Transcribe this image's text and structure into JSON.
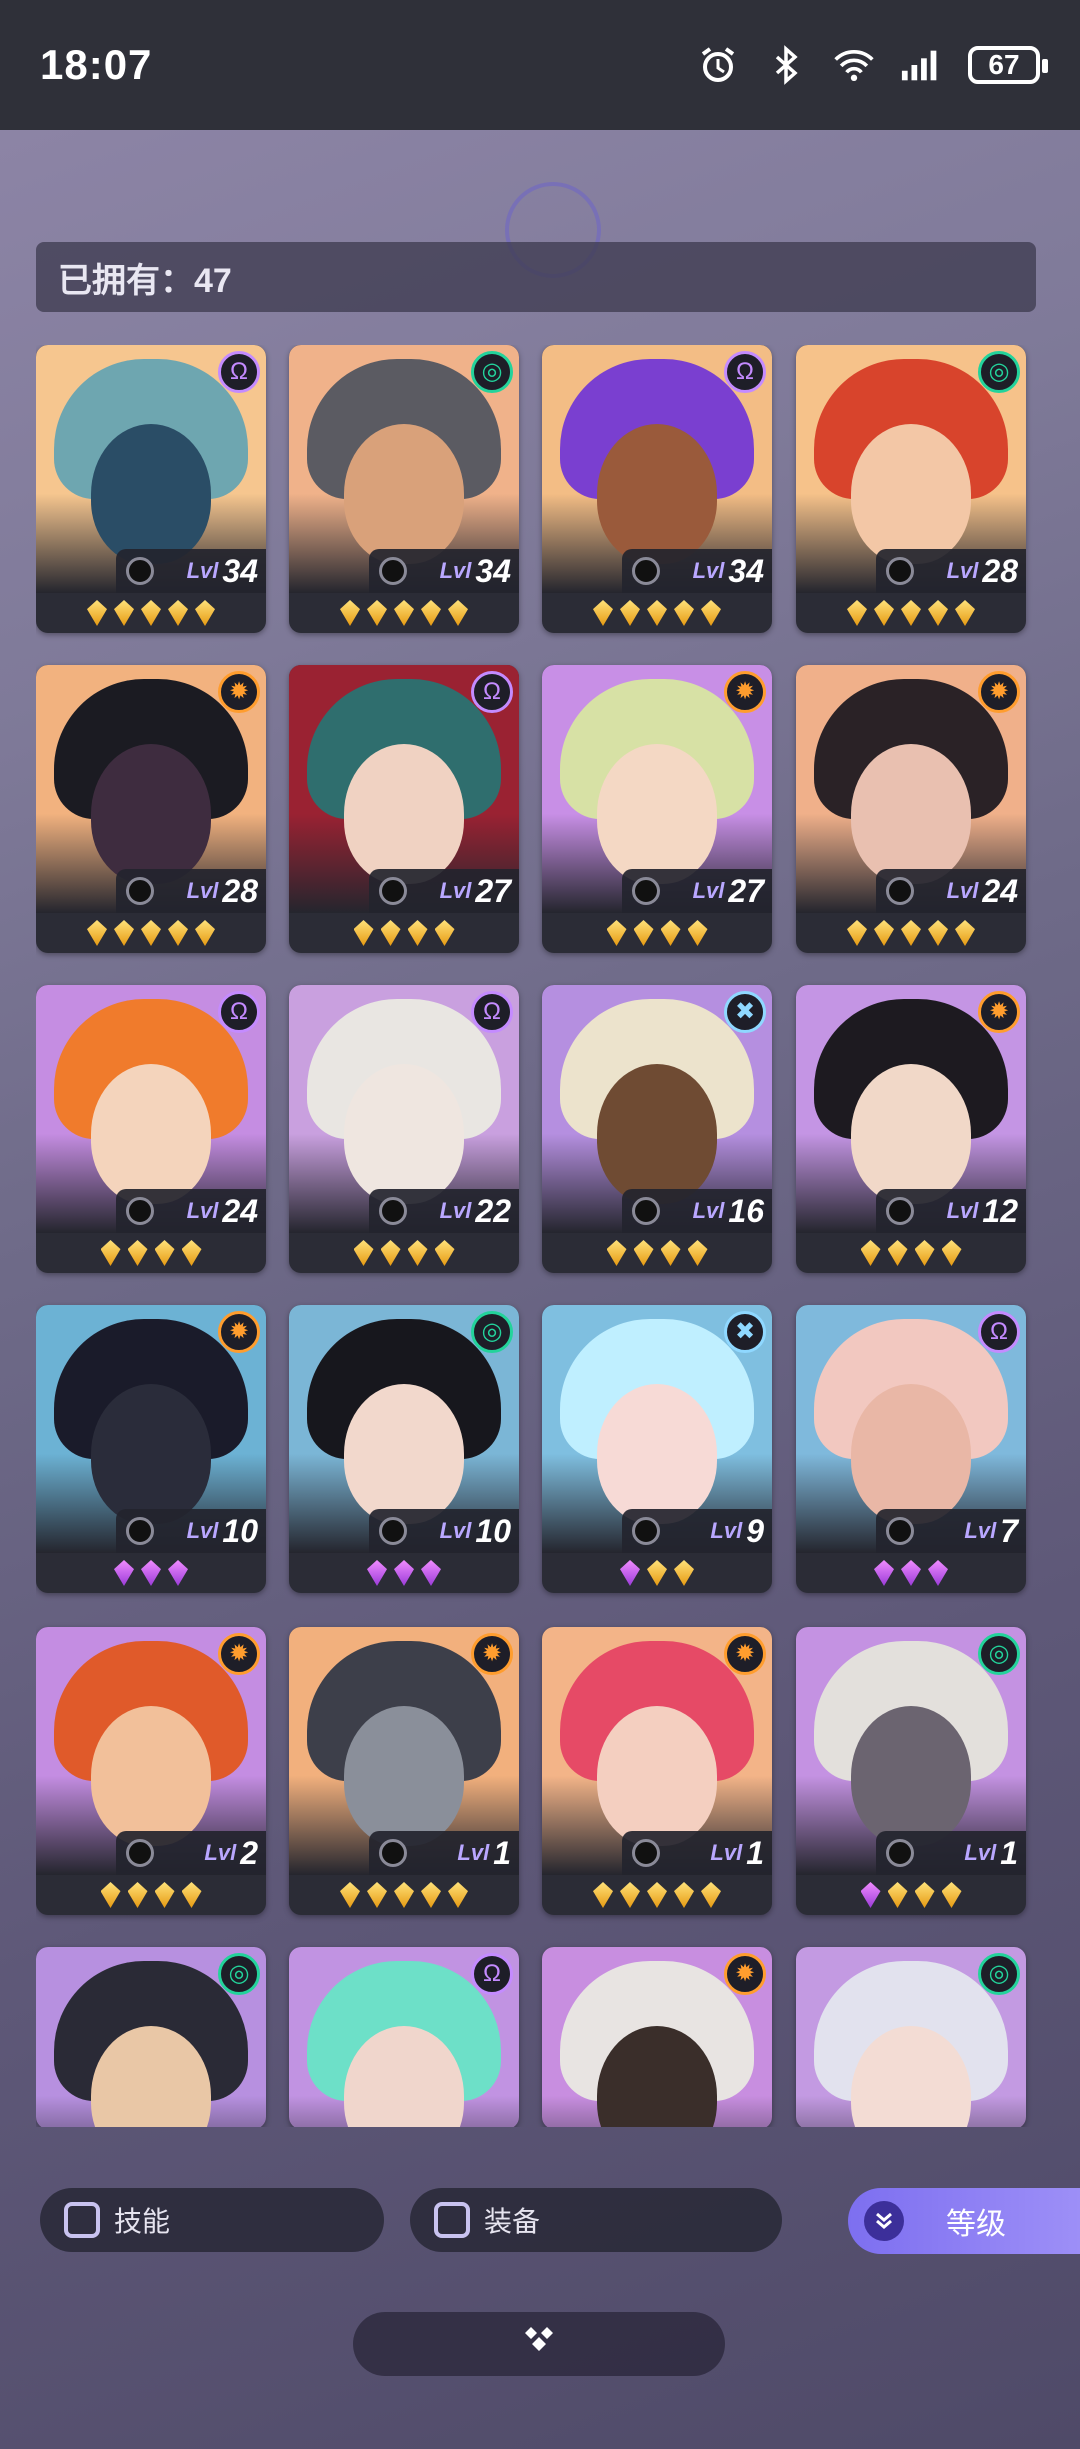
{
  "status_bar": {
    "time": "18:07",
    "battery": "67",
    "icons": [
      "alarm-icon",
      "bluetooth-icon",
      "wifi-icon",
      "signal-icon"
    ]
  },
  "owned": {
    "label": "已拥有：47"
  },
  "colors": {
    "accent": "#8a7cf3",
    "gold_gem": "#f3b62a",
    "purple_gem": "#d35cf1",
    "card_dark": "#2b2c36"
  },
  "cards": [
    {
      "level_label": "Lvl",
      "level": "34",
      "element": "purple-swirl",
      "stars": [
        "gold",
        "gold",
        "gold",
        "gold",
        "gold"
      ],
      "bg": "#f6c68f",
      "hair": "#6ea6b0",
      "skin": "#2a4d66"
    },
    {
      "level_label": "Lvl",
      "level": "34",
      "element": "green-spiral",
      "stars": [
        "gold",
        "gold",
        "gold",
        "gold",
        "gold"
      ],
      "bg": "#f0b28a",
      "hair": "#5b5b62",
      "skin": "#d9a17a"
    },
    {
      "level_label": "Lvl",
      "level": "34",
      "element": "purple-swirl",
      "stars": [
        "gold",
        "gold",
        "gold",
        "gold",
        "gold"
      ],
      "bg": "#f3bd85",
      "hair": "#7a3fd0",
      "skin": "#9a5a3b"
    },
    {
      "level_label": "Lvl",
      "level": "28",
      "element": "green-spiral",
      "stars": [
        "gold",
        "gold",
        "gold",
        "gold",
        "gold"
      ],
      "bg": "#f6c28a",
      "hair": "#d8442c",
      "skin": "#f3c7a6"
    },
    {
      "level_label": "Lvl",
      "level": "28",
      "element": "orange-sun",
      "stars": [
        "gold",
        "gold",
        "gold",
        "gold",
        "gold"
      ],
      "bg": "#f2b27f",
      "hair": "#1b1b22",
      "skin": "#3e2c3f"
    },
    {
      "level_label": "Lvl",
      "level": "27",
      "element": "purple-swirl",
      "stars": [
        "gold",
        "gold",
        "gold",
        "gold"
      ],
      "bg": "#9a2232",
      "hair": "#2f6e6e",
      "skin": "#f0d2c2"
    },
    {
      "level_label": "Lvl",
      "level": "27",
      "element": "orange-sun",
      "stars": [
        "gold",
        "gold",
        "gold",
        "gold"
      ],
      "bg": "#c88fe6",
      "hair": "#d7e1a5",
      "skin": "#f4d8c4"
    },
    {
      "level_label": "Lvl",
      "level": "24",
      "element": "orange-sun",
      "stars": [
        "gold",
        "gold",
        "gold",
        "gold",
        "gold"
      ],
      "bg": "#f0b08a",
      "hair": "#2a2226",
      "skin": "#e9c0b0"
    },
    {
      "level_label": "Lvl",
      "level": "24",
      "element": "purple-swirl",
      "stars": [
        "gold",
        "gold",
        "gold",
        "gold"
      ],
      "bg": "#c58de2",
      "hair": "#f07b2c",
      "skin": "#f4d4bc"
    },
    {
      "level_label": "Lvl",
      "level": "22",
      "element": "purple-swirl",
      "stars": [
        "gold",
        "gold",
        "gold",
        "gold"
      ],
      "bg": "#c9a0df",
      "hair": "#e9e6e2",
      "skin": "#efe6e0"
    },
    {
      "level_label": "Lvl",
      "level": "16",
      "element": "blue-cross",
      "stars": [
        "gold",
        "gold",
        "gold",
        "gold"
      ],
      "bg": "#b58fe0",
      "hair": "#ece3cc",
      "skin": "#6f4b33"
    },
    {
      "level_label": "Lvl",
      "level": "12",
      "element": "orange-sun",
      "stars": [
        "gold",
        "gold",
        "gold",
        "gold"
      ],
      "bg": "#c495e4",
      "hair": "#1d1a20",
      "skin": "#f1d8c8"
    },
    {
      "level_label": "Lvl",
      "level": "10",
      "element": "orange-sun",
      "stars": [
        "purple",
        "purple",
        "purple"
      ],
      "bg": "#6cb2d4",
      "hair": "#1a1b2a",
      "skin": "#2a2c3a"
    },
    {
      "level_label": "Lvl",
      "level": "10",
      "element": "green-spiral",
      "stars": [
        "purple",
        "purple",
        "purple"
      ],
      "bg": "#7bb6d6",
      "hair": "#17171d",
      "skin": "#f2d8cc"
    },
    {
      "level_label": "Lvl",
      "level": "9",
      "element": "blue-cross",
      "stars": [
        "purple",
        "gold",
        "gold"
      ],
      "bg": "#7fbfe0",
      "hair": "#bfefff",
      "skin": "#f7dad6"
    },
    {
      "level_label": "Lvl",
      "level": "7",
      "element": "purple-swirl",
      "stars": [
        "purple",
        "purple",
        "purple"
      ],
      "bg": "#7fb9dc",
      "hair": "#f2c8c0",
      "skin": "#e9b7a6"
    },
    {
      "level_label": "Lvl",
      "level": "2",
      "element": "orange-sun",
      "stars": [
        "gold",
        "gold",
        "gold",
        "gold"
      ],
      "bg": "#c48de2",
      "hair": "#e05a2a",
      "skin": "#f2c09a"
    },
    {
      "level_label": "Lvl",
      "level": "1",
      "element": "orange-sun",
      "stars": [
        "gold",
        "gold",
        "gold",
        "gold",
        "gold"
      ],
      "bg": "#f2b07d",
      "hair": "#3d3f4a",
      "skin": "#8a8f9a"
    },
    {
      "level_label": "Lvl",
      "level": "1",
      "element": "orange-sun",
      "stars": [
        "gold",
        "gold",
        "gold",
        "gold",
        "gold"
      ],
      "bg": "#f3b488",
      "hair": "#e64a66",
      "skin": "#f4cfc0"
    },
    {
      "level_label": "Lvl",
      "level": "1",
      "element": "green-spiral",
      "stars": [
        "purple",
        "gold",
        "gold",
        "gold"
      ],
      "bg": "#c492e2",
      "hair": "#e3e0dc",
      "skin": "#6b6470"
    },
    {
      "level_label": "",
      "level": "",
      "element": "green-spiral",
      "stars": [],
      "bg": "#b790e0",
      "hair": "#2a2a36",
      "skin": "#e9c7a6"
    },
    {
      "level_label": "",
      "level": "",
      "element": "purple-swirl",
      "stars": [],
      "bg": "#c193e2",
      "hair": "#6de0c8",
      "skin": "#f0d6cc"
    },
    {
      "level_label": "",
      "level": "",
      "element": "orange-sun",
      "stars": [],
      "bg": "#c88ee0",
      "hair": "#e8e4e2",
      "skin": "#3a2e2a"
    },
    {
      "level_label": "",
      "level": "",
      "element": "green-spiral",
      "stars": [],
      "bg": "#c39ae2",
      "hair": "#e2e2ee",
      "skin": "#f3dcd4"
    }
  ],
  "filters": {
    "skill_label": "技能",
    "equipment_label": "装备",
    "sort_label": "等级",
    "sort_icon": "chevron-double-down-icon"
  },
  "bottom": {
    "icon": "diamond-cluster-icon"
  }
}
